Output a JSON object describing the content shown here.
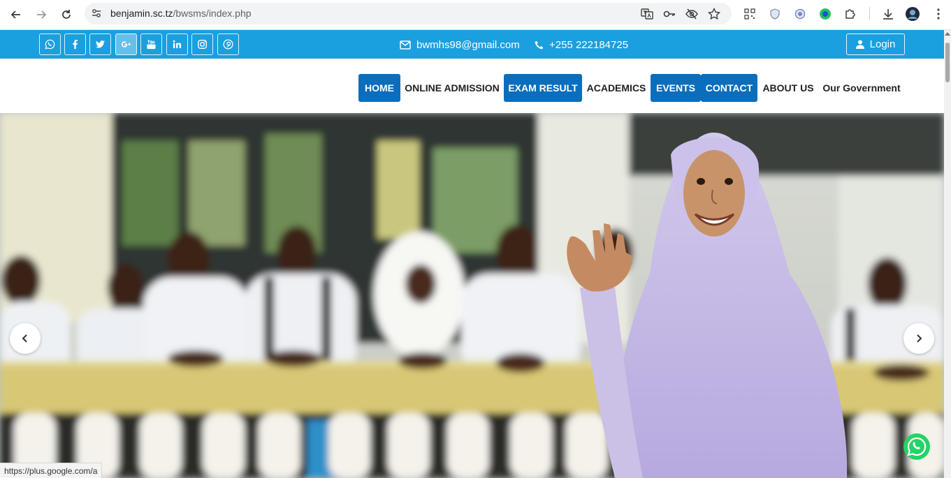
{
  "browser": {
    "url_host": "benjamin.sc.tz",
    "url_path": "/bwsms/index.php",
    "status_url": "https://plus.google.com/a"
  },
  "topbar": {
    "social_icons": [
      "whatsapp-icon",
      "facebook-icon",
      "twitter-icon",
      "google-plus-icon",
      "youtube-icon",
      "linkedin-icon",
      "instagram-icon",
      "pinterest-icon"
    ],
    "email": "bwmhs98@gmail.com",
    "phone": "+255 222184725",
    "login_label": "Login"
  },
  "nav": {
    "items": [
      {
        "label": "HOME",
        "highlighted": true
      },
      {
        "label": "ONLINE ADMISSION",
        "highlighted": false
      },
      {
        "label": "EXAM RESULT",
        "highlighted": true
      },
      {
        "label": "ACADEMICS",
        "highlighted": false
      },
      {
        "label": "EVENTS",
        "highlighted": true
      },
      {
        "label": "CONTACT",
        "highlighted": true
      },
      {
        "label": "ABOUT US",
        "highlighted": false
      },
      {
        "label": "Our Government",
        "highlighted": false
      }
    ]
  },
  "colors": {
    "topbar": "#1a9fdf",
    "nav_highlight": "#0a6ebd",
    "whatsapp": "#25d366"
  }
}
